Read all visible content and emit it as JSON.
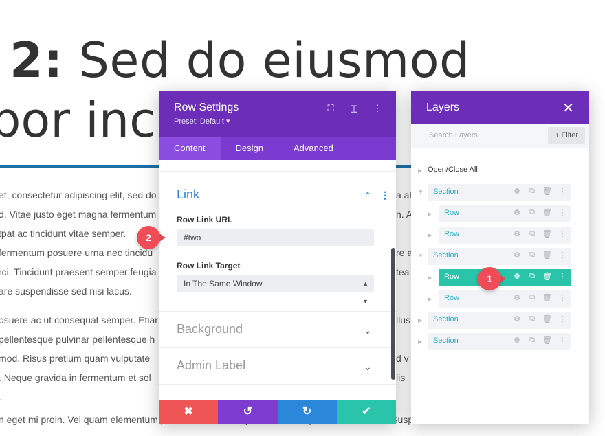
{
  "background": {
    "heading_bold": "2:",
    "heading_rest": " Sed do eiusmod",
    "heading_line2": "por inci",
    "paragraph1": [
      "et, consectetur adipiscing elit, sed do",
      "d. Vitae justo eget magna fermentum",
      "tpat ac tincidunt vitae semper.",
      "fermentum posuere urna nec tincidu",
      "rci. Tincidunt praesent semper feugia",
      "are suspendisse sed nisi lacus."
    ],
    "paragraph2": [
      "osuere ac ut consequat semper. Etiar",
      "pellentesque pulvinar pellentesque h",
      "mod. Risus pretium quam vulputate",
      ". Neque gravida in fermentum et sol",
      "."
    ],
    "right_fragments": [
      "a al",
      "n. A",
      "",
      "re a",
      "tea",
      "",
      "",
      "llus",
      "",
      "d v",
      "lis"
    ],
    "bottom_line": "n eget mi proin. Vel quam elementum pulvinar etiam non quam lacus suspendisse faucibus. Suspendisse in est ante"
  },
  "row_settings": {
    "title": "Row Settings",
    "preset": "Preset: Default ▾",
    "icons": [
      "expand-icon",
      "split-view-icon",
      "more-icon"
    ],
    "tabs": [
      {
        "label": "Content",
        "active": true
      },
      {
        "label": "Design",
        "active": false
      },
      {
        "label": "Advanced",
        "active": false
      }
    ],
    "link_group": {
      "title": "Link",
      "url_label": "Row Link URL",
      "url_value": "#two",
      "target_label": "Row Link Target",
      "target_value": "In The Same Window"
    },
    "background_group": "Background",
    "admin_label_group": "Admin Label",
    "footer": {
      "discard": "✖",
      "undo": "↺",
      "redo": "↻",
      "save": "✔"
    },
    "footer_colors": [
      "#ef5555",
      "#7e3bd0",
      "#2b87da",
      "#29c4a9"
    ]
  },
  "layers": {
    "title": "Layers",
    "close": "✕",
    "search_placeholder": "Search Layers",
    "filter_label": "+ Filter",
    "open_close_all": "Open/Close All",
    "items": [
      {
        "label": "Section",
        "level": 0,
        "active": false
      },
      {
        "label": "Row",
        "level": 1,
        "active": false
      },
      {
        "label": "Row",
        "level": 1,
        "active": false
      },
      {
        "label": "Section",
        "level": 0,
        "active": false
      },
      {
        "label": "Row",
        "level": 1,
        "active": true
      },
      {
        "label": "Row",
        "level": 1,
        "active": false
      },
      {
        "label": "Section",
        "level": 0,
        "active": false
      },
      {
        "label": "Section",
        "level": 0,
        "active": false
      }
    ]
  },
  "annotations": {
    "badge1": "1",
    "badge2": "2"
  },
  "colors": {
    "purple_header": "#6c2eb9",
    "purple_tabs": "#7b3ad0",
    "link_blue": "#2b87da",
    "teal_active": "#29c4a9",
    "badge_red": "#ee4c56"
  }
}
